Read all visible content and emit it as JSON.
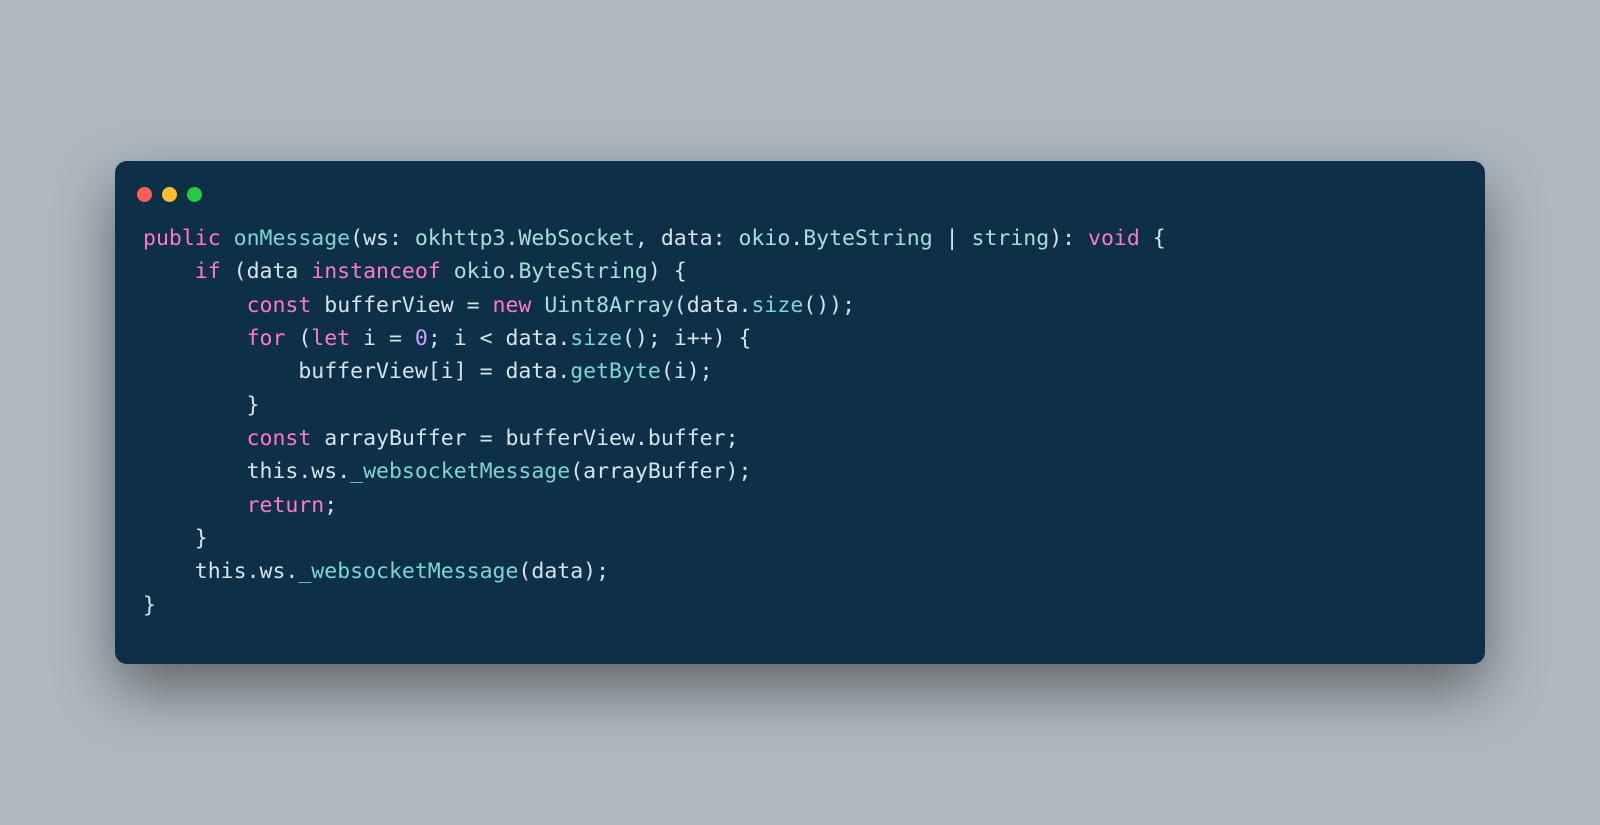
{
  "colors": {
    "background": "#aeb8bf",
    "editor_bg": "#0e2f48",
    "keyword": "#ff79c6",
    "function": "#7ad7d2",
    "type": "#a4e0da",
    "number": "#c9a0ff",
    "default": "#d5e4e9",
    "traffic_red": "#ff5f57",
    "traffic_yellow": "#febc2e",
    "traffic_green": "#28c840"
  },
  "traffic_lights": [
    "red",
    "yellow",
    "green"
  ],
  "code": {
    "language": "typescript",
    "lines": [
      [
        {
          "c": "k",
          "t": "public"
        },
        {
          "c": "p",
          "t": " "
        },
        {
          "c": "fn",
          "t": "onMessage"
        },
        {
          "c": "p",
          "t": "("
        },
        {
          "c": "id",
          "t": "ws"
        },
        {
          "c": "p",
          "t": ": "
        },
        {
          "c": "tp",
          "t": "okhttp3"
        },
        {
          "c": "p",
          "t": "."
        },
        {
          "c": "tp",
          "t": "WebSocket"
        },
        {
          "c": "p",
          "t": ", "
        },
        {
          "c": "id",
          "t": "data"
        },
        {
          "c": "p",
          "t": ": "
        },
        {
          "c": "tp",
          "t": "okio"
        },
        {
          "c": "p",
          "t": "."
        },
        {
          "c": "tp",
          "t": "ByteString"
        },
        {
          "c": "p",
          "t": " | "
        },
        {
          "c": "tp",
          "t": "string"
        },
        {
          "c": "p",
          "t": "): "
        },
        {
          "c": "k",
          "t": "void"
        },
        {
          "c": "p",
          "t": " {"
        }
      ],
      [
        {
          "c": "p",
          "t": "    "
        },
        {
          "c": "k",
          "t": "if"
        },
        {
          "c": "p",
          "t": " ("
        },
        {
          "c": "id",
          "t": "data"
        },
        {
          "c": "p",
          "t": " "
        },
        {
          "c": "k",
          "t": "instanceof"
        },
        {
          "c": "p",
          "t": " "
        },
        {
          "c": "tp",
          "t": "okio"
        },
        {
          "c": "p",
          "t": "."
        },
        {
          "c": "tp",
          "t": "ByteString"
        },
        {
          "c": "p",
          "t": ") {"
        }
      ],
      [
        {
          "c": "p",
          "t": "        "
        },
        {
          "c": "k",
          "t": "const"
        },
        {
          "c": "p",
          "t": " "
        },
        {
          "c": "id",
          "t": "bufferView"
        },
        {
          "c": "p",
          "t": " = "
        },
        {
          "c": "k",
          "t": "new"
        },
        {
          "c": "p",
          "t": " "
        },
        {
          "c": "tp",
          "t": "Uint8Array"
        },
        {
          "c": "p",
          "t": "("
        },
        {
          "c": "id",
          "t": "data"
        },
        {
          "c": "p",
          "t": "."
        },
        {
          "c": "fn",
          "t": "size"
        },
        {
          "c": "p",
          "t": "());"
        }
      ],
      [
        {
          "c": "p",
          "t": "        "
        },
        {
          "c": "k",
          "t": "for"
        },
        {
          "c": "p",
          "t": " ("
        },
        {
          "c": "k",
          "t": "let"
        },
        {
          "c": "p",
          "t": " "
        },
        {
          "c": "id",
          "t": "i"
        },
        {
          "c": "p",
          "t": " = "
        },
        {
          "c": "nm",
          "t": "0"
        },
        {
          "c": "p",
          "t": "; "
        },
        {
          "c": "id",
          "t": "i"
        },
        {
          "c": "p",
          "t": " < "
        },
        {
          "c": "id",
          "t": "data"
        },
        {
          "c": "p",
          "t": "."
        },
        {
          "c": "fn",
          "t": "size"
        },
        {
          "c": "p",
          "t": "(); "
        },
        {
          "c": "id",
          "t": "i"
        },
        {
          "c": "p",
          "t": "++) {"
        }
      ],
      [
        {
          "c": "p",
          "t": "            "
        },
        {
          "c": "id",
          "t": "bufferView"
        },
        {
          "c": "p",
          "t": "["
        },
        {
          "c": "id",
          "t": "i"
        },
        {
          "c": "p",
          "t": "] = "
        },
        {
          "c": "id",
          "t": "data"
        },
        {
          "c": "p",
          "t": "."
        },
        {
          "c": "fn",
          "t": "getByte"
        },
        {
          "c": "p",
          "t": "("
        },
        {
          "c": "id",
          "t": "i"
        },
        {
          "c": "p",
          "t": ");"
        }
      ],
      [
        {
          "c": "p",
          "t": "        }"
        }
      ],
      [
        {
          "c": "p",
          "t": "        "
        },
        {
          "c": "k",
          "t": "const"
        },
        {
          "c": "p",
          "t": " "
        },
        {
          "c": "id",
          "t": "arrayBuffer"
        },
        {
          "c": "p",
          "t": " = "
        },
        {
          "c": "id",
          "t": "bufferView"
        },
        {
          "c": "p",
          "t": "."
        },
        {
          "c": "id",
          "t": "buffer"
        },
        {
          "c": "p",
          "t": ";"
        }
      ],
      [
        {
          "c": "p",
          "t": "        "
        },
        {
          "c": "th",
          "t": "this"
        },
        {
          "c": "p",
          "t": "."
        },
        {
          "c": "id",
          "t": "ws"
        },
        {
          "c": "p",
          "t": "."
        },
        {
          "c": "fn",
          "t": "_websocketMessage"
        },
        {
          "c": "p",
          "t": "("
        },
        {
          "c": "id",
          "t": "arrayBuffer"
        },
        {
          "c": "p",
          "t": ");"
        }
      ],
      [
        {
          "c": "p",
          "t": "        "
        },
        {
          "c": "k",
          "t": "return"
        },
        {
          "c": "p",
          "t": ";"
        }
      ],
      [
        {
          "c": "p",
          "t": "    }"
        }
      ],
      [
        {
          "c": "p",
          "t": "    "
        },
        {
          "c": "th",
          "t": "this"
        },
        {
          "c": "p",
          "t": "."
        },
        {
          "c": "id",
          "t": "ws"
        },
        {
          "c": "p",
          "t": "."
        },
        {
          "c": "fn",
          "t": "_websocketMessage"
        },
        {
          "c": "p",
          "t": "("
        },
        {
          "c": "id",
          "t": "data"
        },
        {
          "c": "p",
          "t": ");"
        }
      ],
      [
        {
          "c": "p",
          "t": "}"
        }
      ]
    ]
  }
}
